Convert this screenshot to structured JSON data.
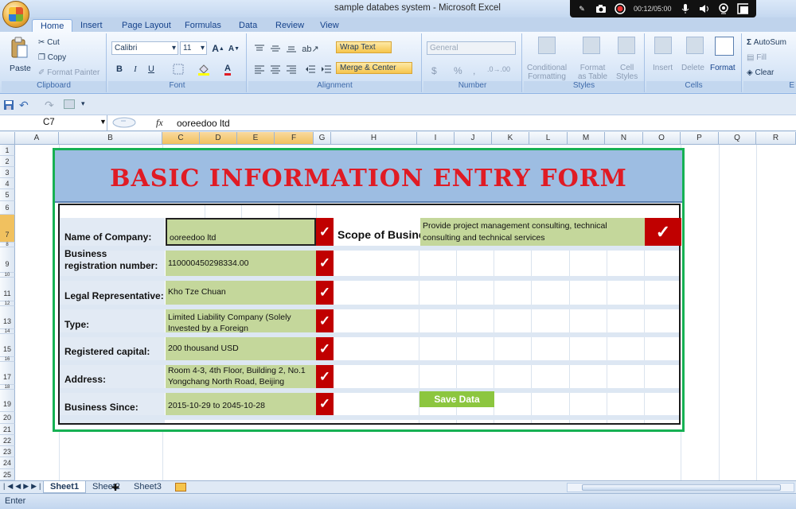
{
  "window": {
    "title": "sample databes system  -  Microsoft Excel"
  },
  "recorder": {
    "time": "00:12/05:00"
  },
  "ribbon_tabs": [
    "Home",
    "Insert",
    "Page Layout",
    "Formulas",
    "Data",
    "Review",
    "View"
  ],
  "ribbon": {
    "clipboard": {
      "paste": "Paste",
      "cut": "Cut",
      "copy": "Copy",
      "format_painter": "Format Painter",
      "label": "Clipboard"
    },
    "font": {
      "name": "Calibri",
      "size": "11",
      "bold": "B",
      "italic": "I",
      "underline": "U",
      "grow": "A",
      "shrink": "A",
      "color_a": "A",
      "label": "Font"
    },
    "alignment": {
      "wrap_text": "Wrap Text",
      "merge_center": "Merge & Center",
      "label": "Alignment"
    },
    "number": {
      "format": "General",
      "currency": "$",
      "percent": "%",
      "comma": ",",
      "label": "Number"
    },
    "styles": {
      "conditional": "Conditional",
      "conditional2": "Formatting",
      "format_as": "Format",
      "format_as2": "as Table",
      "cell_styles": "Cell",
      "cell_styles2": "Styles",
      "label": "Styles"
    },
    "cells": {
      "insert": "Insert",
      "delete": "Delete",
      "format": "Format",
      "label": "Cells"
    },
    "editing": {
      "autosum": "AutoSum",
      "fill": "Fill",
      "clear": "Clear",
      "label": "E"
    }
  },
  "formula_bar": {
    "cell_ref": "C7",
    "fx": "fx",
    "value": "ooreedoo ltd"
  },
  "columns": [
    "A",
    "B",
    "C",
    "D",
    "E",
    "F",
    "G",
    "H",
    "I",
    "J",
    "K",
    "L",
    "M",
    "N",
    "O",
    "P",
    "Q",
    "R"
  ],
  "rows": [
    "1",
    "2",
    "3",
    "4",
    "5",
    "6",
    "7",
    "8",
    "9",
    "10",
    "11",
    "12",
    "13",
    "14",
    "15",
    "16",
    "17",
    "18",
    "19",
    "20",
    "21",
    "22",
    "23",
    "24",
    "25"
  ],
  "form": {
    "title": "BASIC INFORMATION ENTRY FORM",
    "check_glyph": "✓",
    "fields": [
      {
        "label": "Name of Company:",
        "value": "ooreedoo ltd"
      },
      {
        "label": "Business registration number:",
        "value": "110000450298334.00"
      },
      {
        "label": "Legal Representative:",
        "value": "Kho Tze Chuan"
      },
      {
        "label": "Type:",
        "value": "Limited Liability Company (Solely Invested by a Foreign"
      },
      {
        "label": "Registered capital:",
        "value": "200 thousand USD"
      },
      {
        "label": "Address:",
        "value": "Room 4-3, 4th Floor, Building 2, No.1 Yongchang North Road, Beijing"
      },
      {
        "label": "Business Since:",
        "value": "2015-10-29 to 2045-10-28"
      }
    ],
    "scope_label": "Scope of Busine",
    "scope_value": "Provide project management consulting, technical consulting and technical services",
    "save_button": "Save Data"
  },
  "sheets": [
    "Sheet1",
    "Sheet2",
    "Sheet3"
  ],
  "status": "Enter"
}
